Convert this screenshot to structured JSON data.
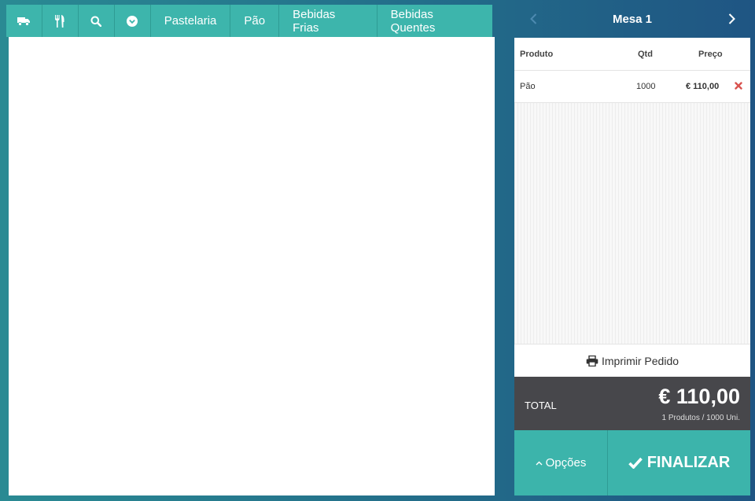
{
  "toolbar": {
    "icons": [
      "truck-icon",
      "utensils-icon",
      "search-icon",
      "chevron-circle-down-icon"
    ],
    "categories": [
      "Pastelaria",
      "Pão",
      "Bebidas Frias",
      "Bebidas Quentes"
    ]
  },
  "order": {
    "title": "Mesa 1",
    "columns": {
      "produto": "Produto",
      "qtd": "Qtd",
      "preco": "Preço"
    },
    "items": [
      {
        "produto": "Pão",
        "qtd": "1000",
        "preco": "€ 110,00"
      }
    ],
    "print_label": "Imprimir Pedido",
    "total_label": "TOTAL",
    "total_value": "€ 110,00",
    "total_summary": "1 Produtos / 1000 Uni.",
    "options_label": "Opções",
    "finalize_label": "FINALIZAR"
  },
  "colors": {
    "accent": "#3cb4ab",
    "total_bg": "#47474b",
    "delete": "#d9534f"
  }
}
